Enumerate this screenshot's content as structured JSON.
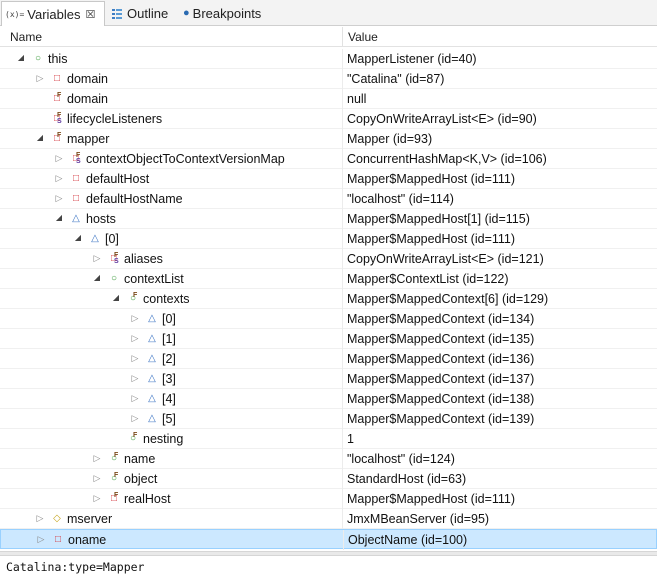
{
  "tabs": [
    {
      "icon": "(x)=",
      "label": "Variables",
      "close": "☒"
    },
    {
      "label": "Outline"
    },
    {
      "label": "Breakpoints"
    }
  ],
  "columns": {
    "name": "Name",
    "value": "Value"
  },
  "rows": [
    {
      "indent": 0,
      "arrow": "expanded",
      "icon": "local",
      "name": "this",
      "value": "MapperListener  (id=40)"
    },
    {
      "indent": 1,
      "arrow": "collapsed",
      "icon": "private",
      "name": "domain",
      "value": "\"Catalina\" (id=87)"
    },
    {
      "indent": 1,
      "arrow": "none",
      "icon": "private-final",
      "name": "domain",
      "value": "null"
    },
    {
      "indent": 1,
      "arrow": "none",
      "icon": "private-final-sync",
      "name": "lifecycleListeners",
      "value": "CopyOnWriteArrayList<E>  (id=90)"
    },
    {
      "indent": 1,
      "arrow": "expanded",
      "icon": "private-final",
      "name": "mapper",
      "value": "Mapper  (id=93)"
    },
    {
      "indent": 2,
      "arrow": "collapsed",
      "icon": "private-final-sync",
      "name": "contextObjectToContextVersionMap",
      "value": "ConcurrentHashMap<K,V>  (id=106)"
    },
    {
      "indent": 2,
      "arrow": "collapsed",
      "icon": "private",
      "name": "defaultHost",
      "value": "Mapper$MappedHost  (id=111)"
    },
    {
      "indent": 2,
      "arrow": "collapsed",
      "icon": "private",
      "name": "defaultHostName",
      "value": "\"localhost\" (id=114)"
    },
    {
      "indent": 2,
      "arrow": "expanded",
      "icon": "package",
      "name": "hosts",
      "value": "Mapper$MappedHost[1]  (id=115)"
    },
    {
      "indent": 3,
      "arrow": "expanded",
      "icon": "package",
      "name": "[0]",
      "value": "Mapper$MappedHost  (id=111)"
    },
    {
      "indent": 4,
      "arrow": "collapsed",
      "icon": "private-final-sync",
      "name": "aliases",
      "value": "CopyOnWriteArrayList<E>  (id=121)"
    },
    {
      "indent": 4,
      "arrow": "expanded",
      "icon": "public",
      "name": "contextList",
      "value": "Mapper$ContextList  (id=122)"
    },
    {
      "indent": 5,
      "arrow": "expanded",
      "icon": "public-final",
      "name": "contexts",
      "value": "Mapper$MappedContext[6]  (id=129)"
    },
    {
      "indent": 6,
      "arrow": "collapsed",
      "icon": "package",
      "name": "[0]",
      "value": "Mapper$MappedContext  (id=134)"
    },
    {
      "indent": 6,
      "arrow": "collapsed",
      "icon": "package",
      "name": "[1]",
      "value": "Mapper$MappedContext  (id=135)"
    },
    {
      "indent": 6,
      "arrow": "collapsed",
      "icon": "package",
      "name": "[2]",
      "value": "Mapper$MappedContext  (id=136)"
    },
    {
      "indent": 6,
      "arrow": "collapsed",
      "icon": "package",
      "name": "[3]",
      "value": "Mapper$MappedContext  (id=137)"
    },
    {
      "indent": 6,
      "arrow": "collapsed",
      "icon": "package",
      "name": "[4]",
      "value": "Mapper$MappedContext  (id=138)"
    },
    {
      "indent": 6,
      "arrow": "collapsed",
      "icon": "package",
      "name": "[5]",
      "value": "Mapper$MappedContext  (id=139)"
    },
    {
      "indent": 5,
      "arrow": "none",
      "icon": "public-final",
      "name": "nesting",
      "value": "1"
    },
    {
      "indent": 4,
      "arrow": "collapsed",
      "icon": "public-final",
      "name": "name",
      "value": "\"localhost\" (id=124)"
    },
    {
      "indent": 4,
      "arrow": "collapsed",
      "icon": "public-final",
      "name": "object",
      "value": "StandardHost  (id=63)"
    },
    {
      "indent": 4,
      "arrow": "collapsed",
      "icon": "private-final",
      "name": "realHost",
      "value": "Mapper$MappedHost  (id=111)"
    },
    {
      "indent": 1,
      "arrow": "collapsed",
      "icon": "protected",
      "name": "mserver",
      "value": "JmxMBeanServer  (id=95)"
    },
    {
      "indent": 1,
      "arrow": "collapsed",
      "icon": "private",
      "name": "oname",
      "value": "ObjectName  (id=100)",
      "selected": true
    }
  ],
  "detail_text": "Catalina:type=Mapper"
}
